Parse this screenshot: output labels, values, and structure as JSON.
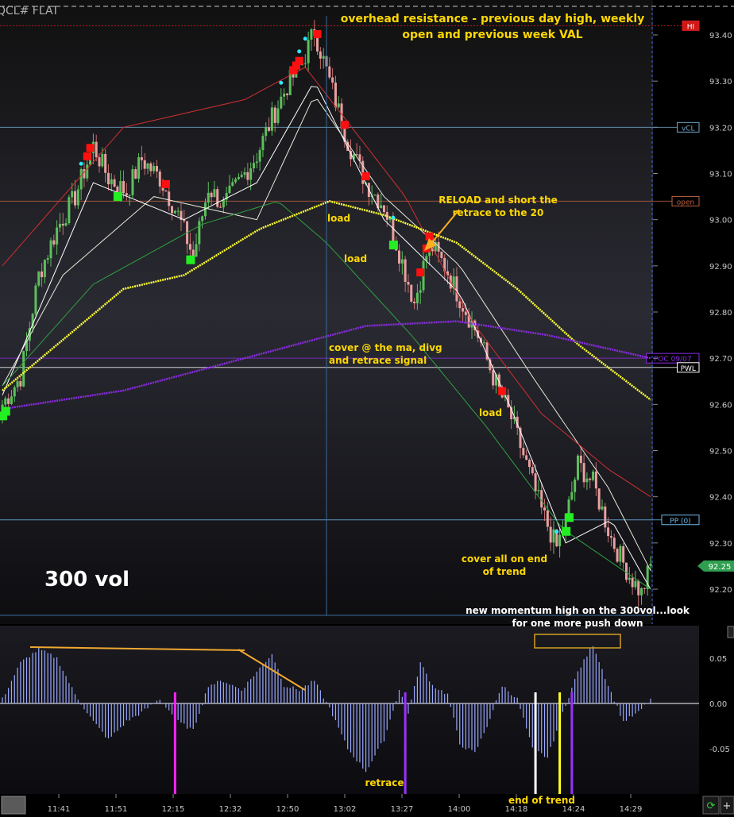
{
  "chart_data": [
    {
      "type": "candlestick",
      "symbol": "QCL# FLAT",
      "interval_label": "300 vol",
      "ylim": [
        92.15,
        93.46
      ],
      "y_ticks": [
        93.4,
        93.3,
        93.2,
        93.1,
        93.0,
        92.9,
        92.8,
        92.7,
        92.6,
        92.5,
        92.4,
        92.3,
        92.2
      ],
      "x_ticks": [
        "11:41",
        "11:51",
        "12:15",
        "12:32",
        "12:50",
        "13:02",
        "13:27",
        "14:00",
        "14:18",
        "14:24",
        "14:29"
      ],
      "price_path": [
        [
          0,
          92.6
        ],
        [
          6,
          92.66
        ],
        [
          12,
          92.88
        ],
        [
          18,
          92.98
        ],
        [
          24,
          93.05
        ],
        [
          30,
          93.16
        ],
        [
          35,
          93.09
        ],
        [
          41,
          93.06
        ],
        [
          46,
          93.13
        ],
        [
          52,
          93.09
        ],
        [
          58,
          93.01
        ],
        [
          63,
          92.92
        ],
        [
          68,
          93.07
        ],
        [
          73,
          93.03
        ],
        [
          79,
          93.09
        ],
        [
          84,
          93.14
        ],
        [
          89,
          93.22
        ],
        [
          94,
          93.29
        ],
        [
          99,
          93.34
        ],
        [
          103,
          93.41
        ],
        [
          108,
          93.3
        ],
        [
          114,
          93.17
        ],
        [
          120,
          93.08
        ],
        [
          126,
          93.03
        ],
        [
          131,
          92.93
        ],
        [
          136,
          92.82
        ],
        [
          141,
          92.95
        ],
        [
          146,
          92.9
        ],
        [
          151,
          92.83
        ],
        [
          157,
          92.75
        ],
        [
          162,
          92.66
        ],
        [
          168,
          92.57
        ],
        [
          173,
          92.47
        ],
        [
          178,
          92.37
        ],
        [
          183,
          92.29
        ],
        [
          186,
          92.35
        ],
        [
          190,
          92.47
        ],
        [
          195,
          92.43
        ],
        [
          201,
          92.31
        ],
        [
          207,
          92.23
        ],
        [
          211,
          92.19
        ],
        [
          214,
          92.25
        ]
      ],
      "series": [
        {
          "name": "",
          "color": "#ffffff",
          "values": [
            [
              0,
              92.62
            ],
            [
              30,
              93.08
            ],
            [
              60,
              93.0
            ],
            [
              84,
              93.08
            ],
            [
              103,
              93.3
            ],
            [
              126,
              93.0
            ],
            [
              151,
              92.84
            ],
            [
              168,
              92.59
            ],
            [
              186,
              92.3
            ],
            [
              201,
              92.35
            ],
            [
              214,
              92.2
            ]
          ]
        },
        {
          "name": "",
          "color": "#e8e8d8",
          "values": [
            [
              0,
              92.64
            ],
            [
              20,
              92.88
            ],
            [
              50,
              93.05
            ],
            [
              84,
              93.0
            ],
            [
              103,
              93.27
            ],
            [
              126,
              93.05
            ],
            [
              151,
              92.9
            ],
            [
              175,
              92.66
            ],
            [
              200,
              92.42
            ],
            [
              214,
              92.24
            ]
          ]
        },
        {
          "name": "",
          "color": "#30a040",
          "values": [
            [
              0,
              92.64
            ],
            [
              30,
              92.86
            ],
            [
              66,
              92.99
            ],
            [
              91,
              93.04
            ],
            [
              107,
              92.95
            ],
            [
              135,
              92.75
            ],
            [
              160,
              92.55
            ],
            [
              185,
              92.33
            ],
            [
              214,
              92.2
            ]
          ]
        },
        {
          "name": "",
          "color": "#d03030",
          "values": [
            [
              0,
              92.9
            ],
            [
              40,
              93.2
            ],
            [
              80,
              93.26
            ],
            [
              100,
              93.33
            ],
            [
              133,
              93.05
            ],
            [
              155,
              92.78
            ],
            [
              178,
              92.58
            ],
            [
              200,
              92.46
            ],
            [
              214,
              92.4
            ]
          ]
        },
        {
          "name": "",
          "color": "#ffff33",
          "values": [
            [
              0,
              92.63
            ],
            [
              40,
              92.85
            ],
            [
              60,
              92.88
            ],
            [
              85,
              92.98
            ],
            [
              108,
              93.04
            ],
            [
              126,
              93.01
            ],
            [
              150,
              92.95
            ],
            [
              170,
              92.85
            ],
            [
              190,
              92.73
            ],
            [
              214,
              92.61
            ]
          ]
        },
        {
          "name": "",
          "color": "#8a2be2",
          "values": [
            [
              0,
              92.59
            ],
            [
              40,
              92.63
            ],
            [
              80,
              92.7
            ],
            [
              120,
              92.77
            ],
            [
              150,
              92.78
            ],
            [
              180,
              92.75
            ],
            [
              214,
              92.7
            ]
          ]
        }
      ],
      "levels": [
        {
          "name": "HI",
          "value": 93.42,
          "color": "#e0201f"
        },
        {
          "name": "vCL",
          "value": 93.2,
          "color": "#6fa8c8"
        },
        {
          "name": "open",
          "value": 93.04,
          "color": "#c06040"
        },
        {
          "name": "POC 09/07",
          "value": 92.7,
          "color": "#8a2be2"
        },
        {
          "name": "PWL",
          "value": 92.68,
          "color": "#ffffff"
        },
        {
          "name": "PP (0)",
          "value": 92.35,
          "color": "#6fb8e8"
        }
      ],
      "last_price_label": "92.25",
      "annotations": [
        "overhead resistance - previous day high, weekly",
        "open and previous week VAL",
        "RELOAD and short the",
        "retrace to the 20",
        "load",
        "load",
        "cover @ the ma, divg",
        "and retrace signal",
        "load",
        "cover all on end",
        "of trend",
        "new momentum high on the 300vol...look",
        "for one more push down"
      ]
    },
    {
      "type": "bar",
      "ylim": [
        -0.085,
        0.085
      ],
      "y_ticks": [
        "0.05",
        "0.00",
        "-0.05"
      ],
      "y_tick_values": [
        0.05,
        0.0,
        -0.05
      ],
      "oscillator_path": [
        [
          0,
          0.005
        ],
        [
          6,
          0.045
        ],
        [
          12,
          0.06
        ],
        [
          18,
          0.05
        ],
        [
          24,
          0.01
        ],
        [
          30,
          -0.02
        ],
        [
          35,
          -0.04
        ],
        [
          41,
          -0.02
        ],
        [
          46,
          -0.01
        ],
        [
          52,
          0.005
        ],
        [
          58,
          -0.02
        ],
        [
          63,
          -0.03
        ],
        [
          68,
          0.02
        ],
        [
          73,
          0.025
        ],
        [
          79,
          0.015
        ],
        [
          84,
          0.035
        ],
        [
          89,
          0.055
        ],
        [
          93,
          0.02
        ],
        [
          98,
          0.015
        ],
        [
          103,
          0.025
        ],
        [
          108,
          -0.005
        ],
        [
          114,
          -0.05
        ],
        [
          120,
          -0.075
        ],
        [
          126,
          -0.04
        ],
        [
          131,
          0.015
        ],
        [
          134,
          -0.01
        ],
        [
          138,
          0.045
        ],
        [
          142,
          0.02
        ],
        [
          147,
          0.01
        ],
        [
          151,
          -0.045
        ],
        [
          156,
          -0.055
        ],
        [
          160,
          -0.025
        ],
        [
          165,
          0.02
        ],
        [
          170,
          0.005
        ],
        [
          175,
          -0.05
        ],
        [
          180,
          -0.06
        ],
        [
          185,
          -0.01
        ],
        [
          190,
          0.035
        ],
        [
          195,
          0.065
        ],
        [
          200,
          0.02
        ],
        [
          205,
          -0.02
        ],
        [
          210,
          -0.01
        ],
        [
          214,
          0.005
        ]
      ],
      "markers": [
        {
          "i": 57,
          "color": "#ff22ff"
        },
        {
          "i": 133,
          "color": "#9a30ff"
        },
        {
          "i": 176,
          "color": "#ffffff"
        },
        {
          "i": 184,
          "color": "#ffff22"
        },
        {
          "i": 188,
          "color": "#9a30ff"
        }
      ],
      "annotations": [
        "retrace",
        "end of trend"
      ]
    }
  ]
}
